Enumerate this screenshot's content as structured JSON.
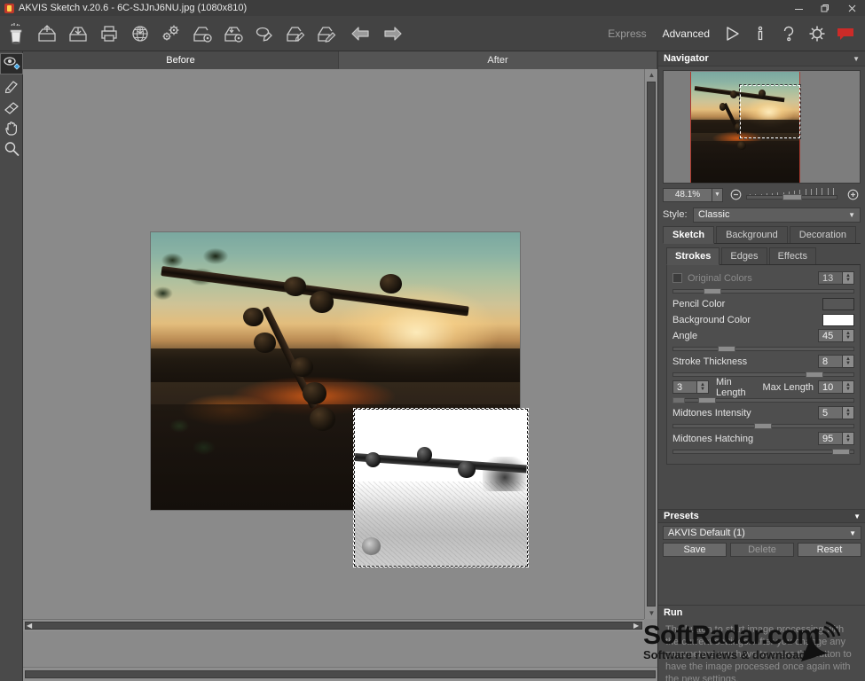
{
  "window": {
    "title": "AKVIS Sketch v.20.6 - 6C-SJJnJ6NU.jpg (1080x810)",
    "app_icon": "akvis-logo-icon",
    "controls": {
      "minimize": "—",
      "maximize": "❐",
      "close": "✕"
    }
  },
  "toolbar": {
    "left_items": [
      {
        "name": "tools-cup-icon",
        "title": "AKVIS Tools"
      },
      {
        "name": "open-image-icon",
        "title": "Open Image"
      },
      {
        "name": "save-image-icon",
        "title": "Save Image"
      },
      {
        "name": "print-image-icon",
        "title": "Print Image"
      },
      {
        "name": "publish-web-icon",
        "title": "Publish to Web"
      },
      {
        "name": "preferences-gears-icon",
        "title": "Preferences"
      },
      {
        "name": "load-settings-icon",
        "title": "Load Settings"
      },
      {
        "name": "save-settings-icon",
        "title": "Save Settings"
      },
      {
        "name": "batch-process-icon",
        "title": "Batch Processing"
      },
      {
        "name": "import-preset-icon",
        "title": "Import Preset"
      },
      {
        "name": "export-preset-icon",
        "title": "Export Preset"
      },
      {
        "name": "undo-arrow-icon",
        "title": "Undo"
      },
      {
        "name": "redo-arrow-icon",
        "title": "Redo"
      }
    ],
    "modes": [
      {
        "label": "Express",
        "active": false
      },
      {
        "label": "Advanced",
        "active": true
      }
    ],
    "right_items": [
      {
        "name": "run-play-icon",
        "title": "Run"
      },
      {
        "name": "info-icon",
        "title": "Information"
      },
      {
        "name": "help-question-icon",
        "title": "Help"
      },
      {
        "name": "settings-gear-icon",
        "title": "Settings"
      },
      {
        "name": "comment-flag-icon",
        "title": "Comments"
      }
    ]
  },
  "left_tools": [
    {
      "name": "quick-preview-tool",
      "label": "Quick Preview",
      "selected": true
    },
    {
      "name": "history-brush-tool",
      "label": "History Brush",
      "selected": false
    },
    {
      "name": "eraser-tool",
      "label": "Eraser",
      "selected": false
    },
    {
      "name": "hand-tool",
      "label": "Hand",
      "selected": false
    },
    {
      "name": "zoom-tool",
      "label": "Zoom",
      "selected": false
    }
  ],
  "canvas": {
    "tabs": [
      {
        "label": "Before",
        "active": true
      },
      {
        "label": "After",
        "active": false
      }
    ]
  },
  "navigator": {
    "header": "Navigator",
    "caret": "▼",
    "zoom_value": "48.1%",
    "zoom_caret": "▼",
    "zoom_out_icon": "zoom-out-icon",
    "zoom_in_icon": "zoom-in-icon"
  },
  "style": {
    "label": "Style:",
    "value": "Classic",
    "caret": "▼"
  },
  "tabs": {
    "main": [
      {
        "label": "Sketch",
        "active": true
      },
      {
        "label": "Background",
        "active": false
      },
      {
        "label": "Decoration",
        "active": false
      }
    ],
    "sub": [
      {
        "label": "Strokes",
        "active": true
      },
      {
        "label": "Edges",
        "active": false
      },
      {
        "label": "Effects",
        "active": false
      }
    ]
  },
  "parameters": [
    {
      "name": "original-colors",
      "label": "Original Colors",
      "value": "13",
      "type": "checkbox-slider",
      "disabled": true,
      "checked": false,
      "slider_pct": 17
    },
    {
      "name": "pencil-color",
      "label": "Pencil Color",
      "type": "color",
      "color": "#565656"
    },
    {
      "name": "background-color",
      "label": "Background Color",
      "type": "color",
      "color": "#ffffff"
    },
    {
      "name": "angle",
      "label": "Angle",
      "value": "45",
      "type": "slider",
      "slider_pct": 25
    },
    {
      "name": "stroke-thickness",
      "label": "Stroke Thickness",
      "value": "8",
      "type": "slider",
      "slider_pct": 73
    },
    {
      "name": "min-length",
      "label": "Min Length",
      "value": "3",
      "type": "dual-left"
    },
    {
      "name": "max-length",
      "label": "Max Length",
      "value": "10",
      "type": "dual-right",
      "slider_pct": 24
    },
    {
      "name": "midtones-intensity",
      "label": "Midtones Intensity",
      "value": "5",
      "type": "slider",
      "slider_pct": 45
    },
    {
      "name": "midtones-hatching",
      "label": "Midtones Hatching",
      "value": "95",
      "type": "slider",
      "slider_pct": 91
    }
  ],
  "presets": {
    "header": "Presets",
    "caret": "▼",
    "selected": "AKVIS Default (1)",
    "dropdown_caret": "▼",
    "buttons": [
      {
        "label": "Save",
        "name": "save-preset-button",
        "disabled": false
      },
      {
        "label": "Delete",
        "name": "delete-preset-button",
        "disabled": true
      },
      {
        "label": "Reset",
        "name": "reset-preset-button",
        "disabled": false
      }
    ]
  },
  "run": {
    "header": "Run",
    "hint": "The button to start image processing with the current settings. After you change any parameters you have to press the button to have the image processed once again with the new settings."
  },
  "watermark": {
    "main": "SoftRadar.com",
    "sub": "Software reviews & downloads",
    "icon": "satellite-dish-icon"
  },
  "colors": {
    "titlebar": "#3d3d3d",
    "toolbar": "#434343",
    "panel": "#4a4a4a",
    "canvas_bg": "#8a8a8a",
    "accent_red": "#c0392b",
    "text": "#e2e2e2"
  }
}
